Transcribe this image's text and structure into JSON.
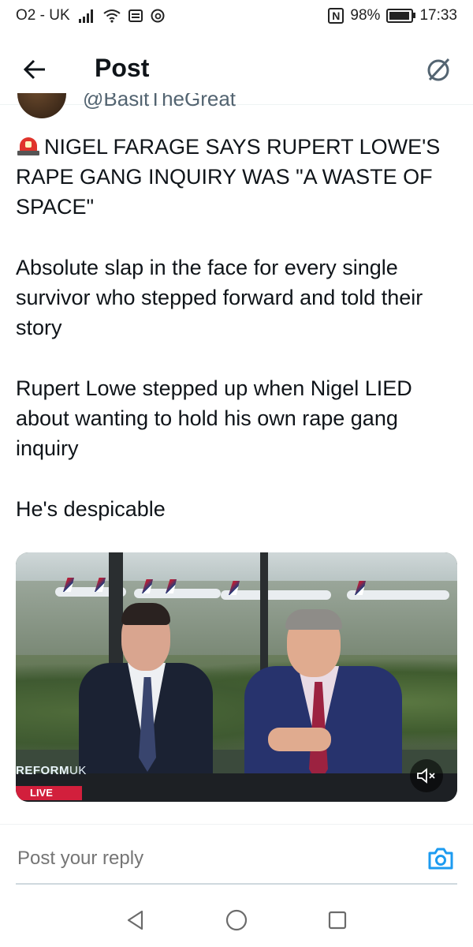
{
  "status_bar": {
    "carrier": "O2 - UK",
    "battery": "98%",
    "battery_level": 0.98,
    "time": "17:33"
  },
  "header": {
    "title": "Post",
    "back_icon": "arrow-left-icon",
    "grok_icon": "grok-icon"
  },
  "author": {
    "handle_partial": "@BasitTheGreat"
  },
  "post": {
    "headline": "NIGEL FARAGE SAYS RUPERT LOWE'S RAPE GANG INQUIRY WAS \"A WASTE OF SPACE\"",
    "paragraphs": [
      "Absolute slap in the face for every single survivor who stepped forward and told their story",
      "Rupert Lowe stepped up when Nigel LIED about wanting to hold his own rape gang inquiry",
      "He's despicable"
    ]
  },
  "video": {
    "logo_left": "REFORM",
    "logo_right": "UK",
    "live_badge": "LIVE",
    "mute_icon": "speaker-muted-icon"
  },
  "reply": {
    "placeholder": "Post your reply",
    "camera_icon": "camera-icon"
  },
  "colors": {
    "text": "#0f1419",
    "secondary": "#536471",
    "accent": "#1d9bf0",
    "live_red": "#d21f3c"
  }
}
